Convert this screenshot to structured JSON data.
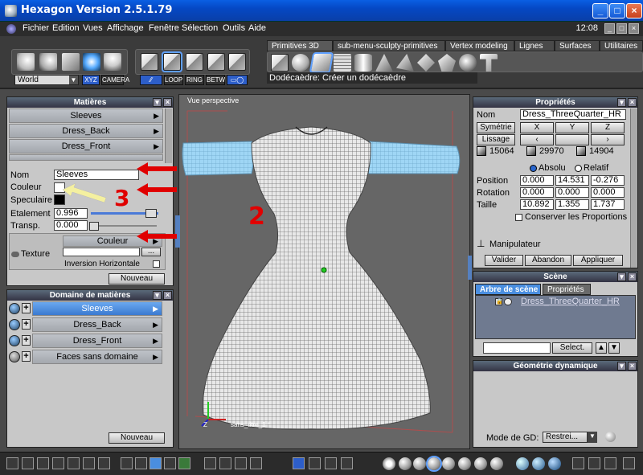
{
  "window": {
    "title": "Hexagon Version 2.5.1.79",
    "minimize": "_",
    "maximize": "□",
    "close": "×"
  },
  "menu": {
    "items": [
      "Fichier",
      "Edition",
      "Vues",
      "Affichage",
      "Fenêtre",
      "Sélection",
      "Outils",
      "Aide"
    ],
    "clock": "12:08"
  },
  "toolbar": {
    "coord_select": "World",
    "xyz": "XYZ",
    "camera": "CAMERA",
    "mode_buttons": [
      "LOOP",
      "RING",
      "BETW"
    ],
    "tabs": [
      "Primitives 3D",
      "sub-menu-sculpty-primitives",
      "Vertex modeling",
      "Lignes",
      "Surfaces",
      "Utilitaires"
    ],
    "active_tab": "Primitives 3D",
    "status": "Dodécaèdre: Créer un dodécaèdre"
  },
  "materials_panel": {
    "title": "Matières",
    "items": [
      "Sleeves",
      "Dress_Back",
      "Dress_Front"
    ],
    "nom_label": "Nom",
    "nom_value": "Sleeves",
    "couleur_label": "Couleur",
    "speculaire_label": "Speculaire",
    "etalement_label": "Etalement",
    "etalement_value": "0.996",
    "transp_label": "Transp.",
    "transp_value": "0.000",
    "texture_label": "Texture",
    "texture_mode": "Couleur",
    "texture_browse": "...",
    "inversion_label": "Inversion Horizontale",
    "nouveau": "Nouveau"
  },
  "domain_panel": {
    "title": "Domaine de matières",
    "items": [
      "Sleeves",
      "Dress_Back",
      "Dress_Front",
      "Faces sans domaine"
    ],
    "selected": "Sleeves",
    "nouveau": "Nouveau"
  },
  "viewport": {
    "label": "Vue perspective",
    "object_label": "sans_titre_1 *",
    "axis_z": "Z"
  },
  "annotations": {
    "num2": "2",
    "num3": "3"
  },
  "properties_panel": {
    "title": "Propriétés",
    "nom_label": "Nom",
    "nom_value": "Dress_ThreeQuarter_HR",
    "symetrie": "Symétrie",
    "lissage": "Lissage",
    "axes": [
      "X",
      "Y",
      "Z"
    ],
    "counts": [
      "15064",
      "29970",
      "14904"
    ],
    "absolu": "Absolu",
    "relatif": "Relatif",
    "position_label": "Position",
    "position": [
      "0.000",
      "14.531",
      "-0.276"
    ],
    "rotation_label": "Rotation",
    "rotation": [
      "0.000",
      "0.000",
      "0.000"
    ],
    "taille_label": "Taille",
    "taille": [
      "10.892",
      "1.355",
      "1.737"
    ],
    "conserver": "Conserver les Proportions",
    "manipulateur": "Manipulateur",
    "valider": "Valider",
    "abandon": "Abandon",
    "appliquer": "Appliquer"
  },
  "scene_panel": {
    "title": "Scène",
    "tab_tree": "Arbre de scène",
    "tab_props": "Propriétés",
    "object": "Dress_ThreeQuarter_HR",
    "select_btn": "Select."
  },
  "gd_panel": {
    "title": "Géométrie dynamique",
    "mode_label": "Mode de GD:",
    "mode_value": "Restrei..."
  },
  "colors": {
    "sleeve_blue": "#8ecaf0",
    "annotation_red": "#e00000",
    "arrow_yellow": "#f4f0a0",
    "selection_blue": "#4a8ee0"
  }
}
